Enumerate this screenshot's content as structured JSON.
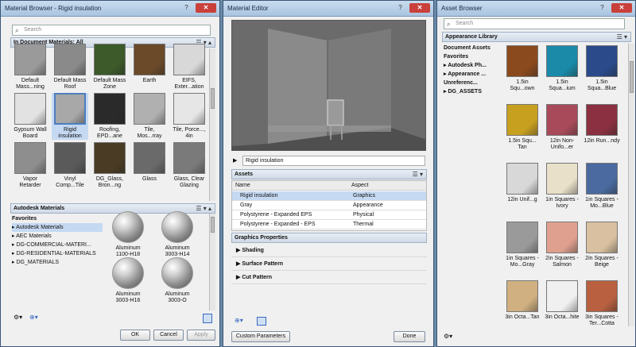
{
  "material_browser": {
    "title": "Material Browser - Rigid insulation",
    "search_placeholder": "Search",
    "section_title": "In Document Materials: All",
    "materials": [
      {
        "label": "Default Mass...ning",
        "color": "#9a9a9a"
      },
      {
        "label": "Default Mass Roof",
        "color": "#8a8a8a"
      },
      {
        "label": "Default Mass Zone",
        "color": "#3c5a2a"
      },
      {
        "label": "Earth",
        "color": "#6b4a2a"
      },
      {
        "label": "EIFS, Exter...ation",
        "color": "#d8d8d8"
      },
      {
        "label": "Gypsum Wall Board",
        "color": "#e2e2e2"
      },
      {
        "label": "Rigid insulation",
        "color": "#a8a8a8"
      },
      {
        "label": "Roofing, EPD...ane",
        "color": "#2a2a2a"
      },
      {
        "label": "Tile, Mos...rray",
        "color": "#b0b0b0"
      },
      {
        "label": "Tile, Porce..., 4in",
        "color": "#e6e6e6"
      },
      {
        "label": "Vapor Retarder",
        "color": "#8e8e8e"
      },
      {
        "label": "Vinyl Comp...Tile",
        "color": "#5a5a5a"
      },
      {
        "label": "DG_Glass, Bron...ng",
        "color": "#4a3c24"
      },
      {
        "label": "Glass",
        "color": "#6a6a6a"
      },
      {
        "label": "Glass, Clear Glazing",
        "color": "#7a7a7a"
      }
    ],
    "library_title": "Autodesk Materials",
    "tree": [
      "Favorites",
      "Autodesk Materials",
      "AEC Materials",
      "DG-COMMERCIAL-MATERI...",
      "DG-RESIDENTIAL-MATERIALS",
      "DG_MATERIALS"
    ],
    "library_items": [
      {
        "label": "Aluminum 1100-H18"
      },
      {
        "label": "Aluminum 3003-H14"
      },
      {
        "label": "Aluminum 3003-H16"
      },
      {
        "label": "Aluminum 3003-O"
      }
    ],
    "ok_label": "OK",
    "cancel_label": "Cancel",
    "apply_label": "Apply"
  },
  "material_editor": {
    "title": "Material Editor",
    "material_name": "Rigid insulation",
    "assets_title": "Assets",
    "columns": [
      "Name",
      "Aspect"
    ],
    "assets": [
      {
        "name": "Rigid insulation",
        "aspect": "Graphics"
      },
      {
        "name": "Gray",
        "aspect": "Appearance"
      },
      {
        "name": "Polystyrene - Expanded EPS",
        "aspect": "Physical"
      },
      {
        "name": "Polystyrene - Expanded - EPS",
        "aspect": "Thermal"
      }
    ],
    "graphics_title": "Graphics Properties",
    "expanders": [
      "Shading",
      "Surface Pattern",
      "Cut Pattern"
    ],
    "custom_params_label": "Custom Parameters",
    "done_label": "Done"
  },
  "asset_browser": {
    "title": "Asset Browser",
    "search_placeholder": "Search",
    "section_title": "Appearance Library",
    "tree": [
      "Document Assets",
      "Favorites",
      "Autodesk Ph...",
      "Appearance ...",
      "Unreferenc...",
      "DG_ASSETS"
    ],
    "assets": [
      {
        "label": "1.5in Squ...own",
        "color": "#8a4a1e"
      },
      {
        "label": "1.5in Squa...ium",
        "color": "#1a8aa8"
      },
      {
        "label": "1.5in Squa...Blue",
        "color": "#2a4a8a"
      },
      {
        "label": "1.5in Squ... Tan",
        "color": "#c8a020"
      },
      {
        "label": "12in Non-Unifo...er",
        "color": "#a84a5a"
      },
      {
        "label": "12in Run...ndy",
        "color": "#8a3040"
      },
      {
        "label": "12in Unif...g",
        "color": "#d8d8d8"
      },
      {
        "label": "1in Squares - Ivory",
        "color": "#e8e0c8"
      },
      {
        "label": "1in Squares - Mo...Blue",
        "color": "#4a6aa0"
      },
      {
        "label": "1in Squares - Mo...Gray",
        "color": "#9a9a9a"
      },
      {
        "label": "2in Squares - Salmon",
        "color": "#e0a090"
      },
      {
        "label": "2in Squares - Beige",
        "color": "#d8c0a0"
      },
      {
        "label": "3in Octa...Tan",
        "color": "#d0b080"
      },
      {
        "label": "3in Octa...hite",
        "color": "#f0f0f0"
      },
      {
        "label": "3in Squares - Ter...Cotta",
        "color": "#b86040"
      }
    ]
  }
}
